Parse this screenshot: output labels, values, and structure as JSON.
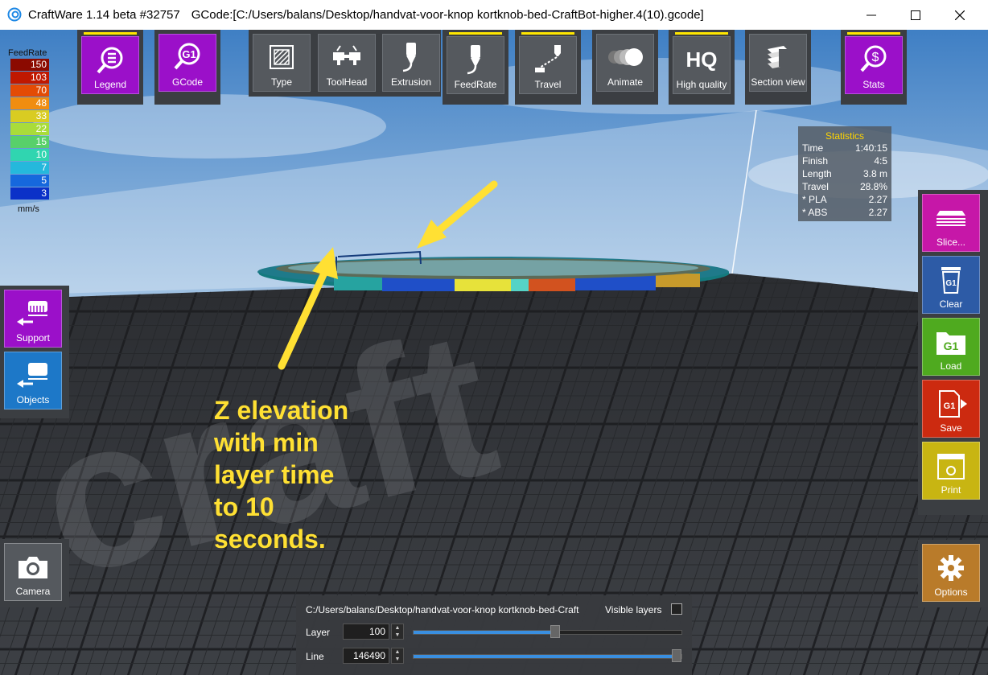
{
  "window": {
    "app_title": "CraftWare 1.14 beta #32757",
    "gcode_title": "GCode:[C:/Users/balans/Desktop/handvat-voor-knop kortknob-bed-CraftBot-higher.4(10).gcode]"
  },
  "toolbar": {
    "legend": "Legend",
    "gcode": "GCode",
    "type": "Type",
    "toolhead": "ToolHead",
    "extrusion": "Extrusion",
    "feedrate": "FeedRate",
    "travel": "Travel",
    "animate": "Animate",
    "high_quality": "High quality",
    "hq_glyph": "HQ",
    "g1_glyph": "G1",
    "section_view": "Section view",
    "stats": "Stats",
    "stats_glyph": "$"
  },
  "feedrate_legend": {
    "header": "FeedRate",
    "unit": "mm/s",
    "entries": [
      {
        "value": "150",
        "color": "#8b0a00"
      },
      {
        "value": "103",
        "color": "#c01800"
      },
      {
        "value": "70",
        "color": "#e34b05"
      },
      {
        "value": "48",
        "color": "#f08d10"
      },
      {
        "value": "33",
        "color": "#d9cc22"
      },
      {
        "value": "22",
        "color": "#a9dc3a"
      },
      {
        "value": "15",
        "color": "#58d06a"
      },
      {
        "value": "10",
        "color": "#30d5b0"
      },
      {
        "value": "7",
        "color": "#25b8dc"
      },
      {
        "value": "5",
        "color": "#1668dd"
      },
      {
        "value": "3",
        "color": "#0b31c8"
      }
    ]
  },
  "statistics": {
    "title": "Statistics",
    "rows": [
      {
        "label": "Time",
        "value": "1:40:15"
      },
      {
        "label": "Finish",
        "value": "4:5"
      },
      {
        "label": "Length",
        "value": "3.8 m"
      },
      {
        "label": "Travel",
        "value": "28.8%"
      },
      {
        "label": "* PLA",
        "value": "2.27"
      },
      {
        "label": "* ABS",
        "value": "2.27"
      }
    ]
  },
  "left_buttons": {
    "support": "Support",
    "objects": "Objects",
    "camera": "Camera"
  },
  "right_buttons": {
    "slice": "Slice...",
    "clear": "Clear",
    "load": "Load",
    "save": "Save",
    "print": "Print",
    "options": "Options"
  },
  "bottom_panel": {
    "path": "C:/Users/balans/Desktop/handvat-voor-knop kortknob-bed-Craft",
    "visible_layers_label": "Visible layers",
    "visible_layers_checked": false,
    "layer_label": "Layer",
    "layer_value": "100",
    "layer_fraction": 0.53,
    "line_label": "Line",
    "line_value": "146490",
    "line_fraction": 1.0
  },
  "annotation": {
    "line1": "Z elevation",
    "line2": "with min",
    "line3": "layer time",
    "line4": "to 10",
    "line5": "seconds."
  },
  "colors": {
    "purple": "#9b10c9",
    "magenta": "#c617a8",
    "clear_blue": "#2d5ba6",
    "load_green": "#4faa1f",
    "save_red": "#cc2a10",
    "print_yellow": "#c8b512",
    "options_gold": "#b97b2a",
    "annotation_yellow": "#ffe033"
  }
}
